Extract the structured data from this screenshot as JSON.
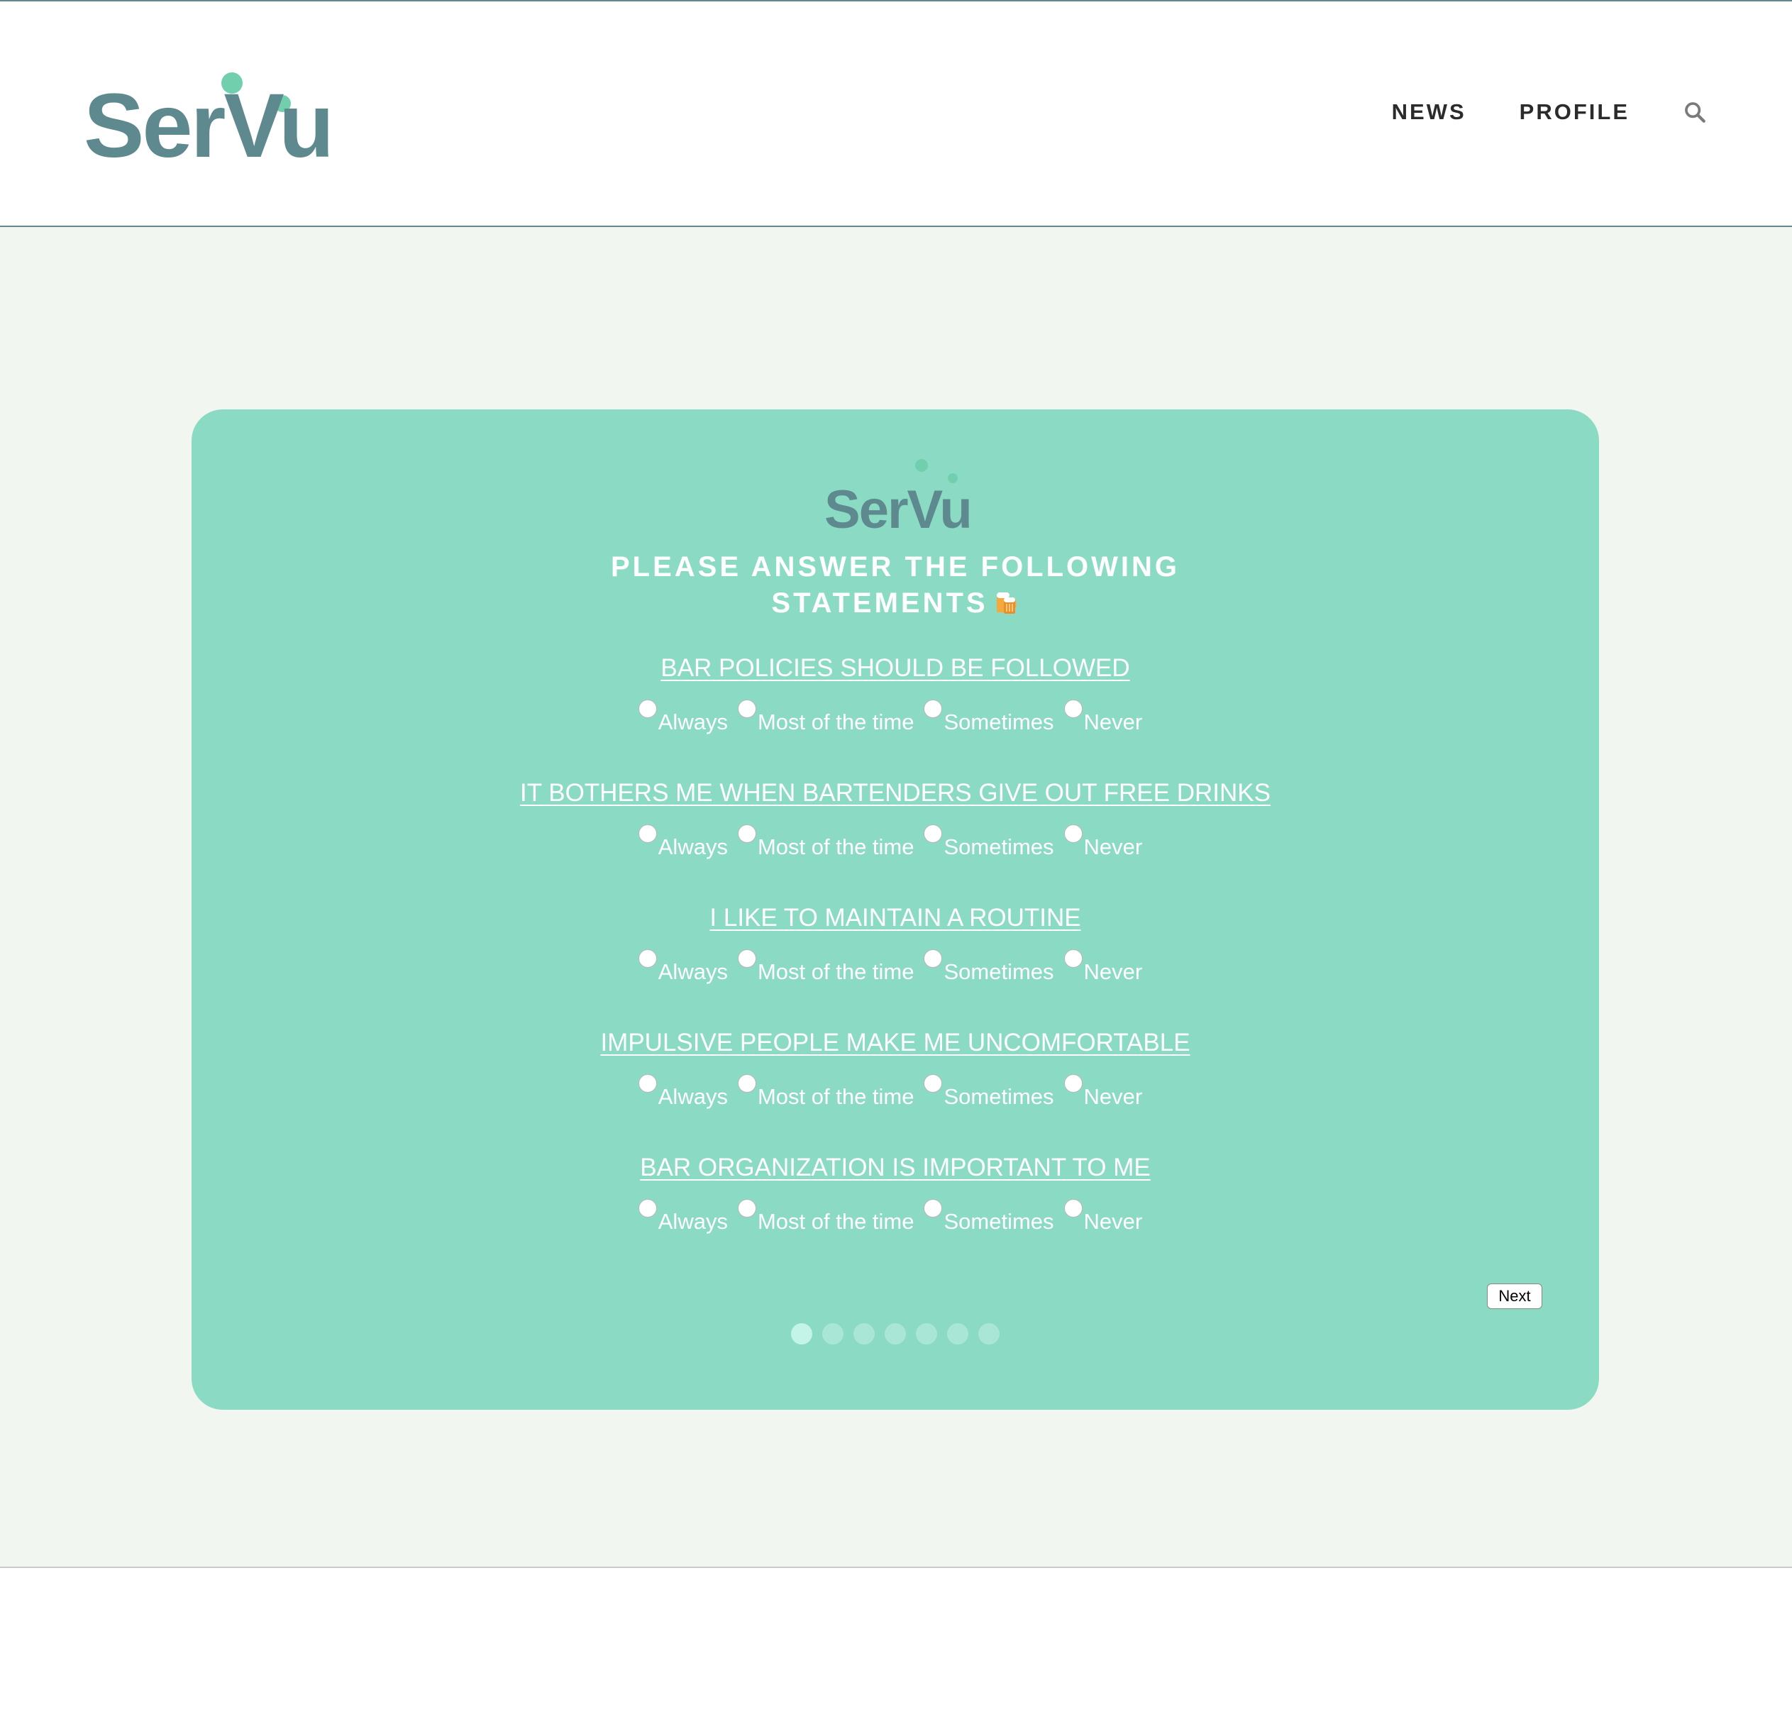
{
  "brand": {
    "logo_text": "SerVu",
    "primary_color": "#5e8a8f",
    "accent_color": "#72cfae",
    "card_color": "#8bdbc4",
    "background_color": "#f1f6f1"
  },
  "nav": {
    "items": [
      {
        "label": "NEWS"
      },
      {
        "label": "PROFILE"
      }
    ],
    "search_icon": "search-icon"
  },
  "survey": {
    "logo_text": "SerVu",
    "title_line1": "PLEASE ANSWER THE FOLLOWING",
    "title_line2": "STATEMENTS",
    "title_icon": "beer-mugs-icon",
    "questions": [
      {
        "text": "BAR POLICIES SHOULD BE FOLLOWED",
        "options": [
          "Always",
          "Most of the time",
          "Sometimes",
          "Never"
        ]
      },
      {
        "text": "IT BOTHERS ME WHEN BARTENDERS GIVE OUT FREE DRINKS",
        "options": [
          "Always",
          "Most of the time",
          "Sometimes",
          "Never"
        ]
      },
      {
        "text": "I LIKE TO MAINTAIN A ROUTINE",
        "options": [
          "Always",
          "Most of the time",
          "Sometimes",
          "Never"
        ]
      },
      {
        "text": "IMPULSIVE PEOPLE MAKE ME UNCOMFORTABLE",
        "options": [
          "Always",
          "Most of the time",
          "Sometimes",
          "Never"
        ]
      },
      {
        "text": "BAR ORGANIZATION IS IMPORTANT TO ME",
        "options": [
          "Always",
          "Most of the time",
          "Sometimes",
          "Never"
        ]
      }
    ],
    "next_label": "Next",
    "page_count": 7,
    "current_page": 1
  }
}
